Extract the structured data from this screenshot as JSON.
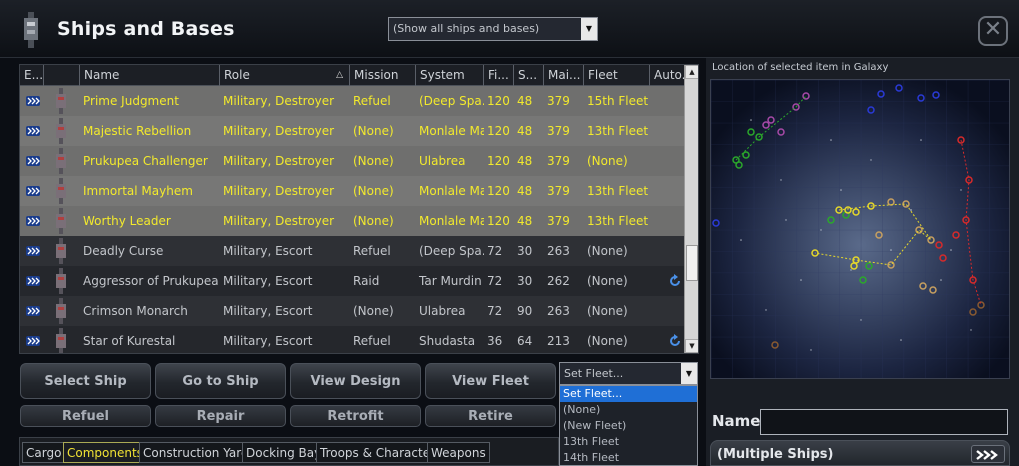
{
  "window": {
    "title": "Ships and Bases",
    "filter_value": "(Show all ships and bases)",
    "close_icon": "close-x-icon"
  },
  "table": {
    "columns": [
      "E...",
      "",
      "Name",
      "Role",
      "Mission",
      "System",
      "Fi...",
      "S...",
      "Mai...",
      "Fleet",
      "Auto..."
    ],
    "sorted_column": "Role",
    "rows": [
      {
        "name": "Prime Judgment",
        "role": "Military, Destroyer",
        "mission": "Refuel",
        "system": "(Deep Spa...",
        "fi": "120",
        "s": "48",
        "mai": "379",
        "fleet": "15th Fleet",
        "selected": true,
        "auto": false
      },
      {
        "name": "Majestic Rebellion",
        "role": "Military, Destroyer",
        "mission": "(None)",
        "system": "Monlale Ma...",
        "fi": "120",
        "s": "48",
        "mai": "379",
        "fleet": "13th Fleet",
        "selected": true,
        "auto": false
      },
      {
        "name": "Prukupea Challenger",
        "role": "Military, Destroyer",
        "mission": "(None)",
        "system": "Ulabrea",
        "fi": "120",
        "s": "48",
        "mai": "379",
        "fleet": "(None)",
        "selected": true,
        "auto": false
      },
      {
        "name": "Immortal Mayhem",
        "role": "Military, Destroyer",
        "mission": "(None)",
        "system": "Monlale Ma...",
        "fi": "120",
        "s": "48",
        "mai": "379",
        "fleet": "13th Fleet",
        "selected": true,
        "auto": false
      },
      {
        "name": "Worthy Leader",
        "role": "Military, Destroyer",
        "mission": "(None)",
        "system": "Monlale Ma...",
        "fi": "120",
        "s": "48",
        "mai": "379",
        "fleet": "13th Fleet",
        "selected": true,
        "auto": false
      },
      {
        "name": "Deadly Curse",
        "role": "Military, Escort",
        "mission": "Refuel",
        "system": "(Deep Spa...",
        "fi": "72",
        "s": "30",
        "mai": "263",
        "fleet": "(None)",
        "selected": false,
        "auto": false
      },
      {
        "name": "Aggressor of Prukupea",
        "role": "Military, Escort",
        "mission": "Raid",
        "system": "Tar Murdin",
        "fi": "72",
        "s": "30",
        "mai": "262",
        "fleet": "(None)",
        "selected": false,
        "auto": true
      },
      {
        "name": "Crimson Monarch",
        "role": "Military, Escort",
        "mission": "(None)",
        "system": "Ulabrea",
        "fi": "72",
        "s": "90",
        "mai": "263",
        "fleet": "(None)",
        "selected": false,
        "auto": false
      },
      {
        "name": "Star of Kurestal",
        "role": "Military, Escort",
        "mission": "Refuel",
        "system": "Shudasta",
        "fi": "36",
        "s": "64",
        "mai": "213",
        "fleet": "(None)",
        "selected": false,
        "auto": true
      }
    ]
  },
  "actions": {
    "select_ship": "Select Ship",
    "go_to_ship": "Go to Ship",
    "view_design": "View Design",
    "view_fleet": "View Fleet",
    "refuel": "Refuel",
    "repair": "Repair",
    "retrofit": "Retrofit",
    "retire": "Retire"
  },
  "fleet_dropdown": {
    "value": "Set Fleet...",
    "options": [
      "Set Fleet...",
      "(None)",
      "(New Fleet)",
      "13th Fleet",
      "14th Fleet"
    ],
    "highlighted": "Set Fleet..."
  },
  "tabs": {
    "items": [
      "Cargo",
      "Components",
      "Construction Yards",
      "Docking Bays",
      "Troops & Characters",
      "Weapons"
    ],
    "active": "Components"
  },
  "right_panel": {
    "map_label": "Location of selected item in Galaxy",
    "name_label": "Name",
    "name_value": "",
    "selection_header": "(Multiple Ships)",
    "selection_icon": "multi-ship-arrows-icon"
  },
  "colors": {
    "selected_row_bg": "#6f6f6e",
    "selected_text": "#f3ea2c",
    "accent_blue": "#1f6fd6"
  }
}
